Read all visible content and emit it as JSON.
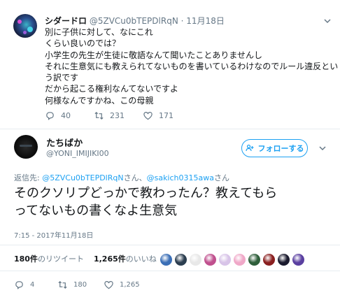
{
  "parent_tweet": {
    "name": "シダードロ",
    "handle": "@5ZVCu0bTEPDlRqN",
    "separator": "·",
    "date": "11月18日",
    "lines": [
      "別に子供に対して、なにこれ",
      "くらい良いのでは？",
      "小学生の先生が生徒に敬語なんて聞いたことありませんし",
      "それに生意気にも教えられてないものを書いているわけなのでルール違反とい",
      "う訳です",
      "だから起こる権利なんてないですよ",
      "何様なんですかね、この母親"
    ],
    "replies": "40",
    "retweets": "231",
    "likes": "171"
  },
  "main_tweet": {
    "name": "たちばか",
    "handle": "@YONI_IMIJIKI00",
    "follow_label": "フォローする",
    "reply_prefix": "返信先: ",
    "mention1": "@5ZVCu0bTEPDlRqN",
    "san1": "さん、",
    "mention2": "@sakich0315awa",
    "san2": "さん",
    "text_lines": [
      "そのクソリプどっかで教わったん？教えてもら",
      "ってないもの書くなよ生意気"
    ],
    "timestamp": "7:15 - 2017年11月18日",
    "retweet_count": "180件",
    "retweet_label": "のリツイート",
    "like_count": "1,265件",
    "like_label": "のいいね",
    "replies": "4",
    "retweets": "180",
    "likes": "1,265"
  },
  "colors": {
    "accent": "#1da1f2",
    "muted": "#657786",
    "text": "#14171a",
    "divider": "#e6ecf0"
  },
  "liker_avatar_colors": [
    "#3b6fb6",
    "#2c3e50",
    "#e8e8e8",
    "#c0508e",
    "#d8c4e8",
    "#f0a8c8",
    "#2e5e3a",
    "#8a1f1f",
    "#1a1a2e",
    "#5a3fa0"
  ]
}
